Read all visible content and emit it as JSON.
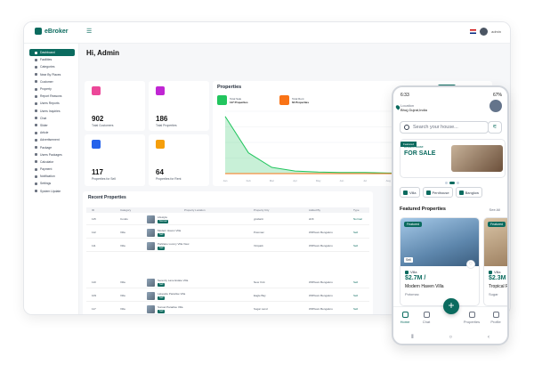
{
  "desktop": {
    "brand": "eBroker",
    "greeting": "Hi, Admin",
    "user": "admin",
    "sidebar": [
      {
        "label": "Dashboard",
        "active": true
      },
      {
        "label": "Facilities"
      },
      {
        "label": "Categories"
      },
      {
        "label": "Near By Places"
      },
      {
        "label": "Customer"
      },
      {
        "label": "Property"
      },
      {
        "label": "Report Reasons"
      },
      {
        "label": "Users Reports"
      },
      {
        "label": "Users Inquiries"
      },
      {
        "label": "Chat"
      },
      {
        "label": "Slider"
      },
      {
        "label": "Article"
      },
      {
        "label": "Advertisement"
      },
      {
        "label": "Package"
      },
      {
        "label": "Users Packages"
      },
      {
        "label": "Calculator"
      },
      {
        "label": "Payment"
      },
      {
        "label": "Notification"
      },
      {
        "label": "Settings"
      },
      {
        "label": "System Update"
      }
    ],
    "stats": [
      {
        "value": "902",
        "label": "Total Customers",
        "color": "#ec4899"
      },
      {
        "value": "186",
        "label": "Total Properties",
        "color": "#c026d3"
      },
      {
        "value": "117",
        "label": "Properties for Sell",
        "color": "#2563eb"
      },
      {
        "value": "64",
        "label": "Properties for Rent",
        "color": "#f59e0b"
      }
    ],
    "properties_chart": {
      "title": "Properties",
      "tabs": [
        "Monthly",
        "Weekly",
        "Daily"
      ],
      "active_tab": "Monthly",
      "mini": [
        {
          "title": "Total Sale",
          "value": "117 Properties",
          "color": "#22c55e"
        },
        {
          "title": "Total Rent",
          "value": "64 Properties",
          "color": "#f97316"
        }
      ]
    },
    "chart_data": {
      "type": "area",
      "x": [
        "Jan",
        "Feb",
        "Mar",
        "Apr",
        "May",
        "Jun",
        "Jul",
        "Aug",
        "Sep",
        "Oct",
        "Nov",
        "Dec"
      ],
      "series": [
        {
          "name": "Sale",
          "values": [
            110,
            40,
            12,
            5,
            3,
            2,
            2,
            1,
            1,
            1,
            1,
            1
          ],
          "color": "#22c55e"
        },
        {
          "name": "Rent",
          "values": [
            0,
            0,
            0,
            0,
            0,
            0,
            0,
            0,
            0,
            0,
            0,
            0
          ],
          "color": "#f97316"
        }
      ],
      "ylim": [
        0,
        120
      ],
      "grid": true,
      "legend": "bottom-right"
    },
    "recent": {
      "title": "Recent Properties",
      "headers": [
        "ID",
        "Category",
        "Property Location",
        "Property City",
        "Added By",
        "Type"
      ],
      "rows": [
        {
          "id": "115",
          "cat": "Condo",
          "name": "Lifestyle",
          "city": "ypsilanti",
          "by": "shift",
          "type": "Normal"
        },
        {
          "id": "112",
          "cat": "Villa",
          "name": "Modern Haven Villa",
          "city": "Potomac",
          "by": "WRTeam Bengaluru",
          "type": "Sell"
        },
        {
          "id": "111",
          "cat": "Villa",
          "name": "Parklane Luxury Villa View",
          "city": "Vinipark",
          "by": "WRTeam Bengaluru",
          "type": "Sell"
        },
        {
          "id": "110",
          "cat": "Villa",
          "name": "Serenity Lane Estate Villa",
          "city": "New York",
          "by": "WRTeam Bengaluru",
          "type": "Sell"
        },
        {
          "id": "109",
          "cat": "Villa",
          "name": "Lakeside Paradise Villa",
          "city": "Eagle Bay",
          "by": "WRTeam Bengaluru",
          "type": "Sell"
        },
        {
          "id": "117",
          "cat": "Villa",
          "name": "Sunset Paradise Villa",
          "city": "Sugar Land",
          "by": "WRTeam Bengaluru",
          "type": "Sell"
        },
        {
          "id": "116",
          "cat": "Villa",
          "name": "Modern Elegance Villa",
          "city": "Cheyni",
          "by": "WRTeam Bengaluru",
          "type": "Sell"
        },
        {
          "id": "114",
          "cat": "Villa",
          "name": "Serene Shore Villa",
          "city": "Buffalo Point",
          "by": "WRTeam Bengaluru",
          "type": "Sell"
        }
      ]
    }
  },
  "mobile": {
    "time": "6:33",
    "battery": "67%",
    "location_label": "Location",
    "location": "Bhuj,Gujrat,India",
    "search_placeholder": "Search your house...",
    "banner": {
      "tag": "Featured",
      "small": "Dream House",
      "big": "FOR SALE"
    },
    "categories": [
      "Villa",
      "Penthouse",
      "Banglow"
    ],
    "featured_title": "Featured Properties",
    "see_all": "See All",
    "cards": [
      {
        "badge": "Featured",
        "label": "Sell",
        "type": "Villa",
        "price": "$2.7M /",
        "name": "Modern Haven Villa",
        "loc": "Potomac"
      },
      {
        "badge": "Featured",
        "label": "Sell",
        "type": "Villa",
        "price": "$2.3M",
        "name": "Tropical P",
        "loc": "Sugar"
      }
    ],
    "nav": [
      "Home",
      "Chat",
      "Properties",
      "Profile"
    ]
  }
}
